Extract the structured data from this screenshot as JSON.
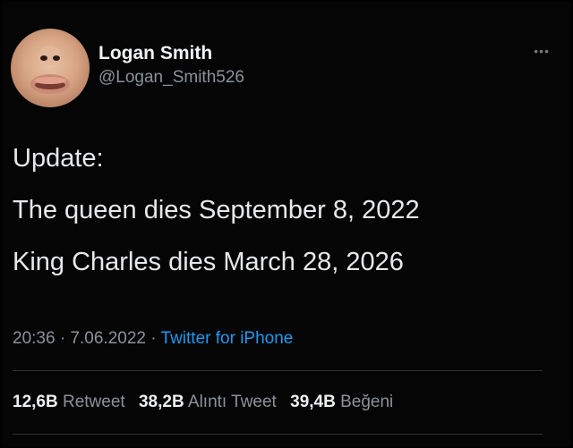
{
  "author": {
    "display_name": "Logan Smith",
    "handle": "@Logan_Smith526"
  },
  "more_icon": "more-dots-icon",
  "tweet": {
    "lines": [
      "Update:",
      "The queen dies September 8, 2022",
      "King Charles dies March 28, 2026"
    ],
    "time": "20:36",
    "date": "7.06.2022",
    "separator": "·",
    "source": "Twitter for iPhone"
  },
  "stats": {
    "retweets": {
      "value": "12,6B",
      "label": "Retweet"
    },
    "quotes": {
      "value": "38,2B",
      "label": "Alıntı Tweet"
    },
    "likes": {
      "value": "39,4B",
      "label": "Beğeni"
    }
  },
  "colors": {
    "background": "#000000",
    "text": "#e7e9ea",
    "secondary": "#8b9299",
    "link": "#1d9bf0"
  }
}
